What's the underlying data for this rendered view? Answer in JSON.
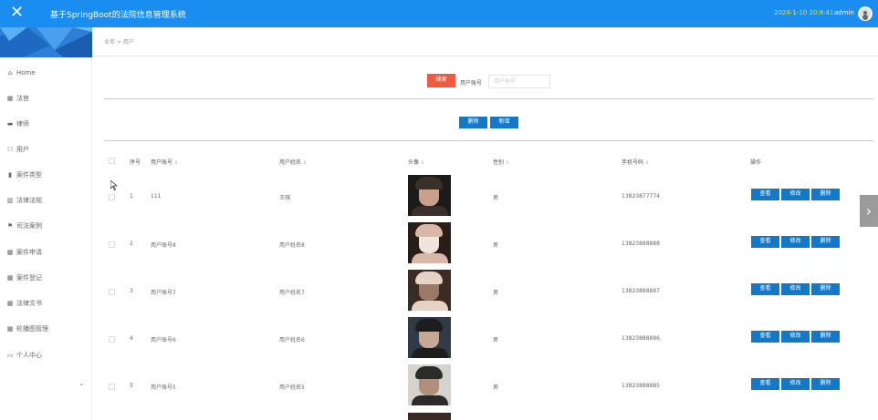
{
  "header": {
    "close_glyph": "✕",
    "title": "基于SpringBoot的法院信息管理系统",
    "datetime": "2024-1-10 20:8:41",
    "user": "admin",
    "colors": {
      "bar": "#1a8df0",
      "datetime": "#ffe000"
    }
  },
  "sidebar": {
    "items": [
      {
        "label": "Home",
        "icon": "home-icon"
      },
      {
        "label": "法官",
        "icon": "grid-icon"
      },
      {
        "label": "律师",
        "icon": "briefcase-icon"
      },
      {
        "label": "用户",
        "icon": "users-icon"
      },
      {
        "label": "案件类型",
        "icon": "clipboard-icon"
      },
      {
        "label": "法律法规",
        "icon": "bar-chart-icon"
      },
      {
        "label": "司法案例",
        "icon": "flag-icon"
      },
      {
        "label": "案件申请",
        "icon": "grid-icon"
      },
      {
        "label": "案件登记",
        "icon": "grid-icon"
      },
      {
        "label": "法律文书",
        "icon": "grid-icon"
      },
      {
        "label": "轮播图管理",
        "icon": "grid-icon"
      },
      {
        "label": "个人中心",
        "icon": "calendar-icon"
      }
    ]
  },
  "breadcrumb": "业务 > 用户",
  "search": {
    "button": "搜索",
    "label": "用户账号",
    "placeholder": "用户账号"
  },
  "actions": {
    "delete": "删除",
    "add": "新增"
  },
  "table": {
    "headers": [
      "序号",
      "用户账号",
      "用户姓名",
      "头像",
      "性别",
      "手机号码",
      "操作"
    ],
    "rows": [
      {
        "index": "1",
        "account": "111",
        "name": "王强",
        "gender": "男",
        "phone": "13823877774"
      },
      {
        "index": "2",
        "account": "用户账号8",
        "name": "用户姓名8",
        "gender": "男",
        "phone": "13823888888"
      },
      {
        "index": "3",
        "account": "用户账号7",
        "name": "用户姓名7",
        "gender": "男",
        "phone": "13823888887"
      },
      {
        "index": "4",
        "account": "用户账号6",
        "name": "用户姓名6",
        "gender": "男",
        "phone": "13823888886"
      },
      {
        "index": "5",
        "account": "用户账号5",
        "name": "用户姓名5",
        "gender": "男",
        "phone": "13823888885"
      }
    ],
    "row_buttons": {
      "view": "查看",
      "edit": "修改",
      "delete": "删除"
    }
  }
}
